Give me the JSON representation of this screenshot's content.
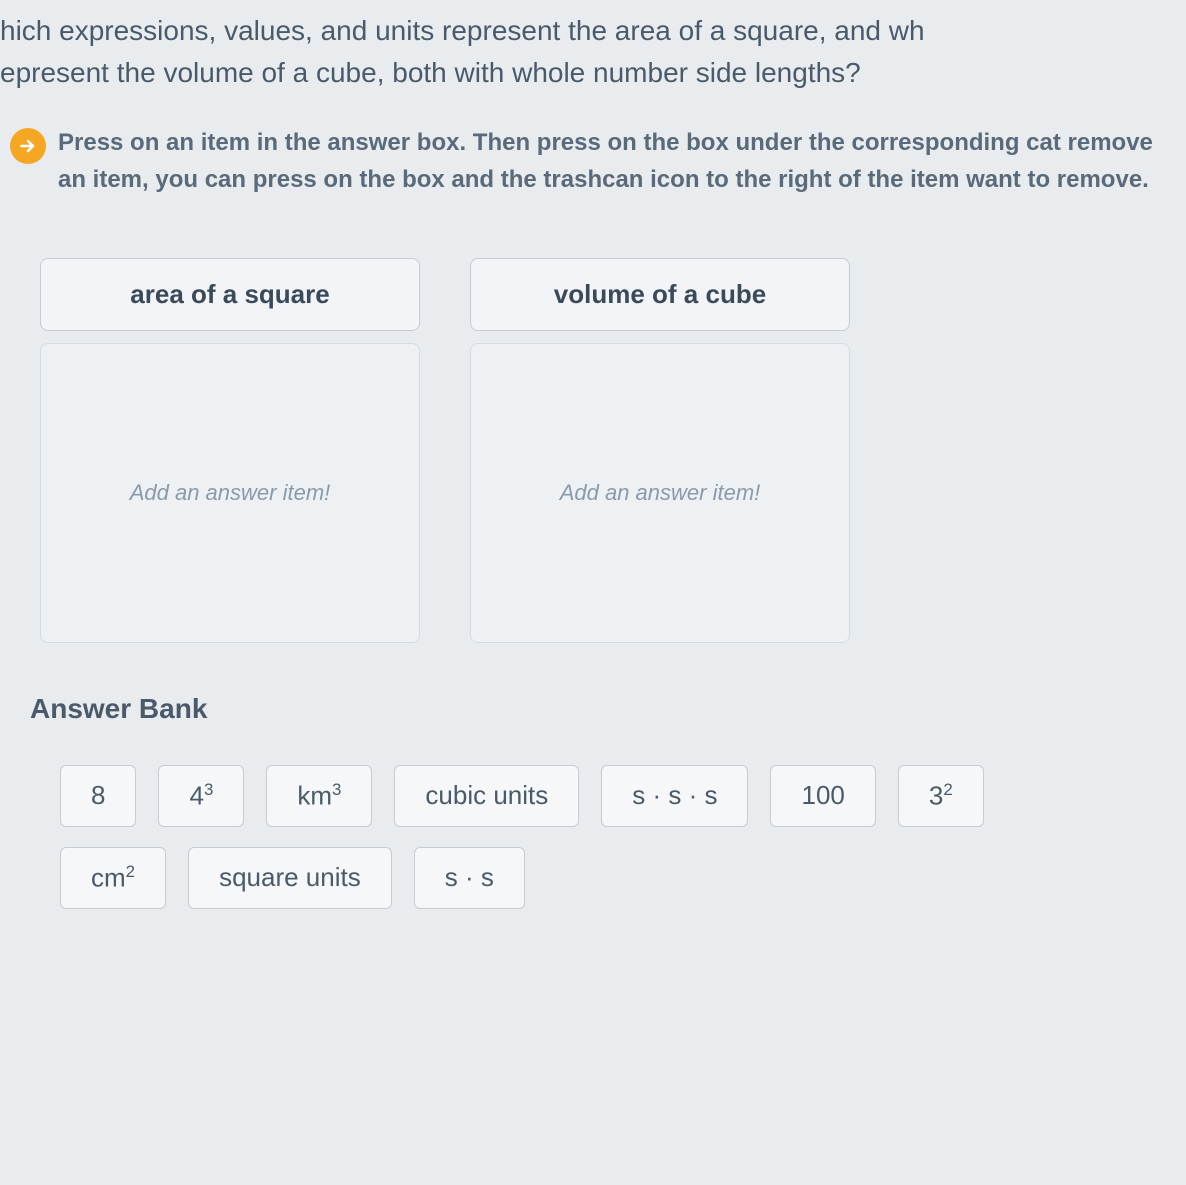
{
  "question": {
    "line1": "hich expressions, values, and units represent the area of a square, and wh",
    "line2": "epresent the volume of a cube, both with whole number side lengths?"
  },
  "instruction": "Press on an item in the answer box. Then press on the box under the corresponding cat remove an item, you can press on the box and the trashcan icon to the right of the item want to remove.",
  "categories": [
    {
      "label": "area of a square",
      "placeholder": "Add an answer item!"
    },
    {
      "label": "volume of a cube",
      "placeholder": "Add an answer item!"
    }
  ],
  "answer_bank": {
    "title": "Answer Bank",
    "items_row1": [
      {
        "display": "8",
        "html": "8"
      },
      {
        "display": "4^3",
        "html": "4<sup>3</sup>"
      },
      {
        "display": "km^3",
        "html": "km<sup>3</sup>"
      },
      {
        "display": "cubic units",
        "html": "cubic units"
      },
      {
        "display": "s · s · s",
        "html": "s · s · s"
      },
      {
        "display": "100",
        "html": "100"
      },
      {
        "display": "3^2",
        "html": "3<sup>2</sup>"
      }
    ],
    "items_row2": [
      {
        "display": "cm^2",
        "html": "cm<sup>2</sup>"
      },
      {
        "display": "square units",
        "html": "square units"
      },
      {
        "display": "s · s",
        "html": "s · s"
      }
    ]
  }
}
